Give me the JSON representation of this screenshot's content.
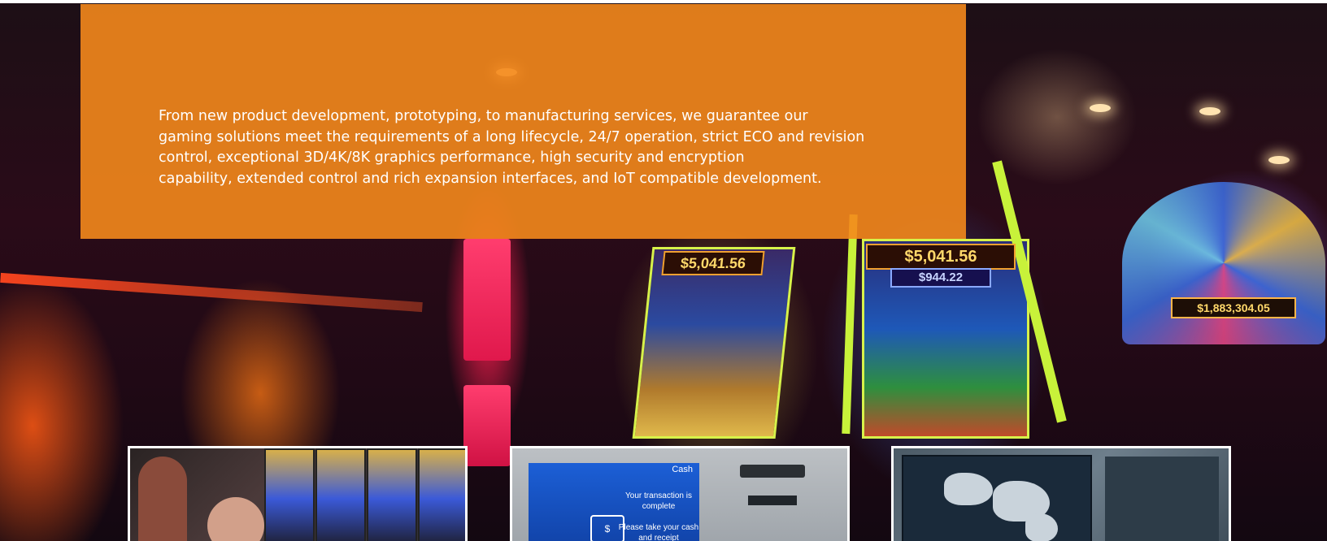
{
  "hero": {
    "description": "From new product development, prototyping, to manufacturing services, we guarantee our\ngaming solutions meet the requirements of a long lifecycle, 24/7 operation, strict ECO and revision\ncontrol, exceptional 3D/4K/8K graphics performance, high security and encryption\ncapability, extended control and rich expansion interfaces, and IoT compatible development.",
    "overlay_color": "#F4881C"
  },
  "background_displays": {
    "machine_a_jackpot": "$5,041.56",
    "machine_b_jackpot": "$5,041.56",
    "machine_b_secondary": "$944.22",
    "wheel_jackpot": "$1,883,304.05"
  },
  "thumbnails": [
    {
      "name": "slot-players",
      "icon": "people-playing-slots-image"
    },
    {
      "name": "atm-kiosk",
      "icon": "atm-image",
      "screen_title": "Cash",
      "screen_message": "Your transaction is complete\n\nPlease take your cash and receipt"
    },
    {
      "name": "control-monitoring",
      "icon": "world-map-screen-image"
    }
  ]
}
